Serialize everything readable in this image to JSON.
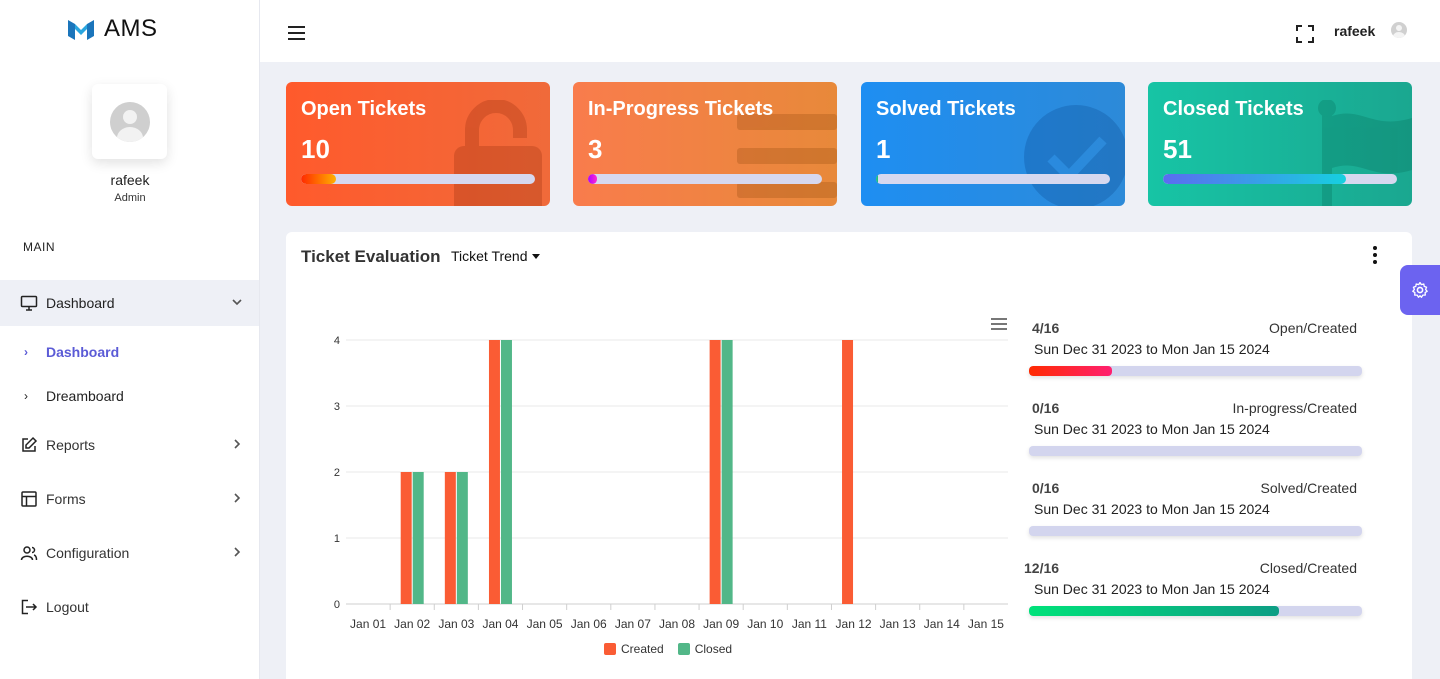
{
  "app": {
    "name": "AMS"
  },
  "user": {
    "name": "rafeek",
    "role": "Admin"
  },
  "sidebar": {
    "section": "MAIN",
    "items": [
      {
        "label": "Dashboard",
        "icon": "monitor-icon",
        "expanded": true
      },
      {
        "label": "Reports",
        "icon": "edit-icon"
      },
      {
        "label": "Forms",
        "icon": "table-icon"
      },
      {
        "label": "Configuration",
        "icon": "users-icon"
      },
      {
        "label": "Logout",
        "icon": "logout-icon"
      }
    ],
    "sub_items": [
      {
        "label": "Dashboard",
        "current": true
      },
      {
        "label": "Dreamboard",
        "current": false
      }
    ]
  },
  "topbar": {
    "username": "rafeek"
  },
  "stats": [
    {
      "title": "Open Tickets",
      "value": "10",
      "progress": 0.15,
      "color": "#ff5a2c"
    },
    {
      "title": "In-Progress Tickets",
      "value": "3",
      "progress": 0.04,
      "color": "#f97c4c"
    },
    {
      "title": "Solved Tickets",
      "value": "1",
      "progress": 0.01,
      "color": "#1e8ef2"
    },
    {
      "title": "Closed Tickets",
      "value": "51",
      "progress": 0.78,
      "color": "#17c4a5"
    }
  ],
  "evaluation": {
    "title": "Ticket Evaluation",
    "dropdown": "Ticket Trend",
    "ratios": [
      {
        "fraction": "4/16",
        "label": "Open/Created",
        "range": "Sun Dec 31 2023 to Mon Jan 15 2024",
        "progress": 0.25
      },
      {
        "fraction": "0/16",
        "label": "In-progress/Created",
        "range": "Sun Dec 31 2023 to Mon Jan 15 2024",
        "progress": 0
      },
      {
        "fraction": "0/16",
        "label": "Solved/Created",
        "range": "Sun Dec 31 2023 to Mon Jan 15 2024",
        "progress": 0
      },
      {
        "fraction": "12/16",
        "label": "Closed/Created",
        "range": "Sun Dec 31 2023 to Mon Jan 15 2024",
        "progress": 0.75
      }
    ]
  },
  "chart_data": {
    "type": "bar",
    "title": "",
    "xlabel": "",
    "ylabel": "",
    "ylim": [
      0,
      4
    ],
    "yticks": [
      0,
      1,
      2,
      3,
      4
    ],
    "grid": true,
    "legend_position": "bottom",
    "categories": [
      "Jan 01",
      "Jan 02",
      "Jan 03",
      "Jan 04",
      "Jan 05",
      "Jan 06",
      "Jan 07",
      "Jan 08",
      "Jan 09",
      "Jan 10",
      "Jan 11",
      "Jan 12",
      "Jan 13",
      "Jan 14",
      "Jan 15"
    ],
    "series": [
      {
        "name": "Created",
        "color": "#fa5c34",
        "values": [
          0,
          2,
          2,
          4,
          0,
          0,
          0,
          0,
          4,
          0,
          0,
          4,
          0,
          0,
          0
        ]
      },
      {
        "name": "Closed",
        "color": "#52b788",
        "values": [
          0,
          2,
          2,
          4,
          0,
          0,
          0,
          0,
          4,
          0,
          0,
          0,
          0,
          0,
          0
        ]
      }
    ]
  }
}
